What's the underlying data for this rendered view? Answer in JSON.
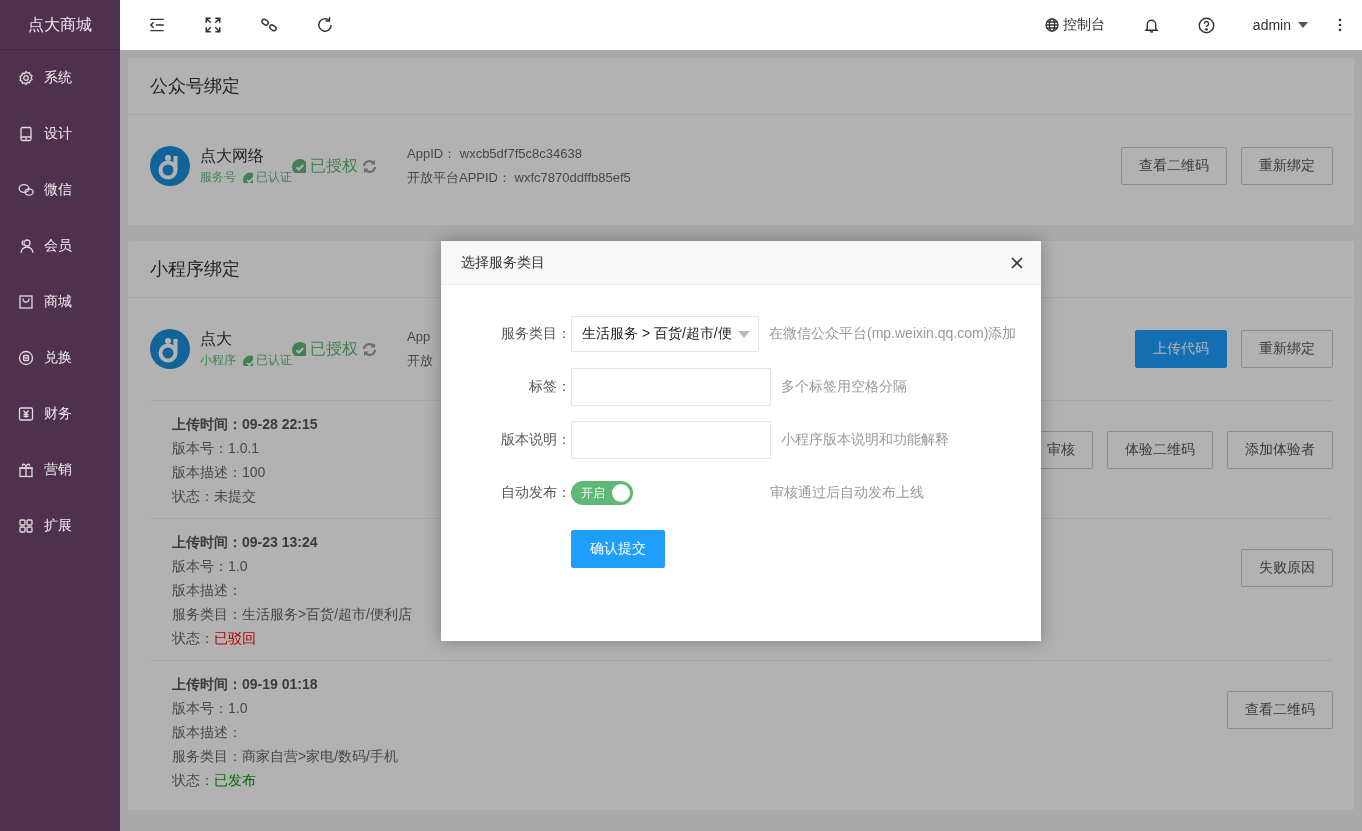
{
  "sidebar": {
    "brand": "点大商城",
    "items": [
      {
        "label": "系统"
      },
      {
        "label": "设计"
      },
      {
        "label": "微信"
      },
      {
        "label": "会员"
      },
      {
        "label": "商城"
      },
      {
        "label": "兑换"
      },
      {
        "label": "财务"
      },
      {
        "label": "营销"
      },
      {
        "label": "扩展"
      }
    ]
  },
  "topbar": {
    "console": "控制台",
    "user": "admin"
  },
  "cards": [
    {
      "title": "公众号绑定",
      "account": {
        "name": "点大网络",
        "type": "服务号",
        "verified": "已认证",
        "auth": "已授权"
      },
      "info": [
        "AppID： wxcb5df7f5c8c34638",
        "开放平台APPID： wxfc7870ddffb85ef5"
      ],
      "buttons": [
        {
          "label": "查看二维码",
          "kind": "default"
        },
        {
          "label": "重新绑定",
          "kind": "default"
        }
      ]
    },
    {
      "title": "小程序绑定",
      "account": {
        "name": "点大",
        "type": "小程序",
        "verified": "已认证",
        "auth": "已授权"
      },
      "info": [
        "App",
        "开放"
      ],
      "buttons": [
        {
          "label": "上传代码",
          "kind": "primary"
        },
        {
          "label": "重新绑定",
          "kind": "default"
        }
      ],
      "versions": [
        {
          "upload_time": "上传时间：09-28 22:15",
          "lines": [
            {
              "label": "版本号：",
              "value": "1.0.1"
            },
            {
              "label": "版本描述：",
              "value": "100"
            }
          ],
          "status": {
            "label": "状态：",
            "value": "未提交",
            "color": "#474747"
          },
          "buttons": [
            "审核",
            "体验二维码",
            "添加体验者"
          ]
        },
        {
          "upload_time": "上传时间：09-23 13:24",
          "lines": [
            {
              "label": "版本号：",
              "value": "1.0"
            },
            {
              "label": "版本描述："
            },
            {
              "label": "服务类目：",
              "value": "生活服务>百货/超市/便利店"
            }
          ],
          "status": {
            "label": "状态：",
            "value": "已驳回",
            "color": "#b30000"
          },
          "buttons": [
            "失败原因"
          ]
        },
        {
          "upload_time": "上传时间：09-19 01:18",
          "lines": [
            {
              "label": "版本号：",
              "value": "1.0"
            },
            {
              "label": "版本描述："
            },
            {
              "label": "服务类目：",
              "value": "商家自营>家电/数码/手机"
            }
          ],
          "status": {
            "label": "状态：",
            "value": "已发布",
            "color": "#006b00"
          },
          "buttons": [
            "查看二维码"
          ]
        }
      ]
    }
  ],
  "dialog": {
    "title": "选择服务类目",
    "fields": [
      {
        "kind": "select",
        "label": "服务类目：",
        "value": "生活服务 > 百货/超市/便",
        "hint": "在微信公众平台(mp.weixin.qq.com)添加"
      },
      {
        "kind": "input",
        "label": "标签：",
        "hint": "多个标签用空格分隔"
      },
      {
        "kind": "input",
        "label": "版本说明：",
        "hint": "小程序版本说明和功能解释"
      },
      {
        "kind": "switch",
        "label": "自动发布：",
        "on": true,
        "text": "开启",
        "hint": "审核通过后自动发布上线"
      }
    ],
    "submit": "确认提交"
  }
}
